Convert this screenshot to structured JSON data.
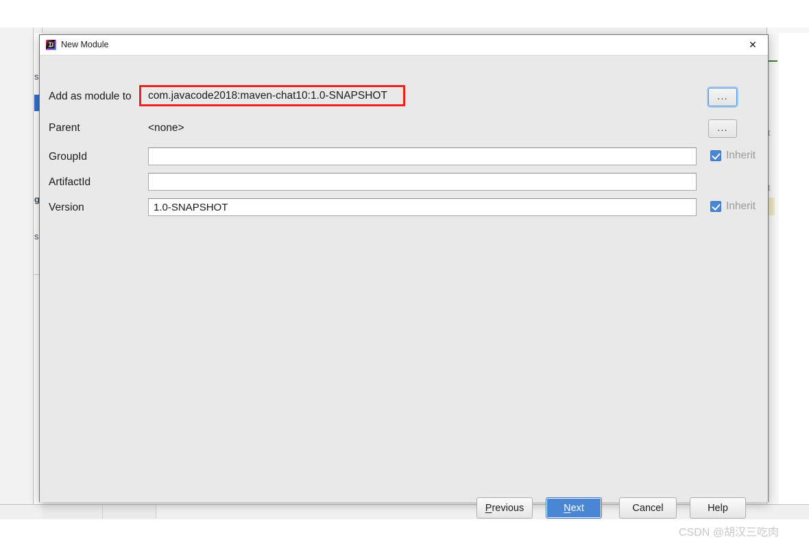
{
  "window": {
    "title": "New Module",
    "icon": "intellij-idea-icon",
    "close_label": "✕"
  },
  "form": {
    "rows": [
      {
        "label": "Add as module to",
        "value": "com.javacode2018:maven-chat10:1.0-SNAPSHOT",
        "kind": "combo",
        "browse": "...",
        "browse_focused": true
      },
      {
        "label": "Parent",
        "value": "<none>",
        "kind": "static",
        "browse": "..."
      },
      {
        "label": "GroupId",
        "value": "",
        "kind": "input",
        "inherit": "Inherit",
        "inherit_checked": true
      },
      {
        "label": "ArtifactId",
        "value": "",
        "kind": "input"
      },
      {
        "label": "Version",
        "value": "1.0-SNAPSHOT",
        "kind": "input",
        "inherit": "Inherit",
        "inherit_checked": true
      }
    ]
  },
  "footer": {
    "buttons": [
      {
        "label": "Previous",
        "mnemonic": "P",
        "primary": false
      },
      {
        "label": "Next",
        "mnemonic": "N",
        "primary": true
      },
      {
        "label": "Cancel",
        "mnemonic": "",
        "primary": false
      },
      {
        "label": "Help",
        "mnemonic": "",
        "primary": false
      }
    ]
  },
  "annotation": {
    "color": "#ee2020",
    "target": "module-combo-field"
  },
  "background": {
    "tree_letters": [
      "s",
      "g",
      "s"
    ],
    "right_letters": [
      "t",
      "t"
    ],
    "selection_color": "#2f6fd0"
  },
  "watermark": {
    "text": "CSDN @胡汉三吃肉"
  }
}
